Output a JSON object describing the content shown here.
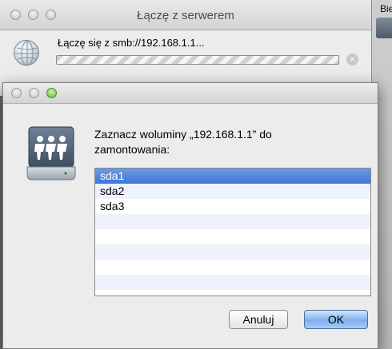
{
  "desktop": {
    "item_label": "Bie"
  },
  "connecting_window": {
    "title": "Łączę z serwerem",
    "status_text": "Łączę się z smb://192.168.1.1..."
  },
  "mount_dialog": {
    "prompt_line1": "Zaznacz woluminy „192.168.1.1” do",
    "prompt_line2": "zamontowania:",
    "volumes": [
      {
        "label": "sda1",
        "selected": true
      },
      {
        "label": "sda2",
        "selected": false
      },
      {
        "label": "sda3",
        "selected": false
      }
    ],
    "cancel_label": "Anuluj",
    "ok_label": "OK"
  },
  "colors": {
    "selection": "#3d76d8",
    "default_button": "#7fb0ee",
    "window_bg": "#ececec"
  },
  "icons": [
    "globe-icon",
    "network-drive-icon",
    "progress-cancel-icon"
  ]
}
